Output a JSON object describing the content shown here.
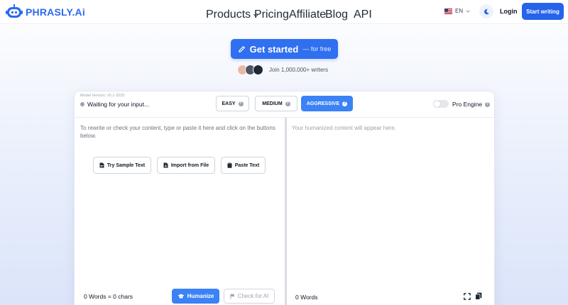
{
  "brand": {
    "name": "PHRASLY.Ai",
    "color": "#2b6af0"
  },
  "nav": {
    "products": "Products",
    "pricing": "Pricing",
    "affiliate": "Affiliate",
    "blog": "Blog",
    "api": "API"
  },
  "header": {
    "language": "EN",
    "language_icon": "us-flag-icon",
    "theme_icon": "moon-icon",
    "login": "Login",
    "start_writing": "Start writing",
    "accent": "#2563eb"
  },
  "hero": {
    "cta_main": "Get started",
    "cta_sub": "— for free",
    "cta_icon": "pencil-icon",
    "writers_text": "Join 1,000,000+ writers"
  },
  "editor": {
    "model_version": "Model Version: v5.1-2025",
    "status": "Waiting for your input...",
    "modes": [
      {
        "label": "EASY",
        "active": false
      },
      {
        "label": "MEDIUM",
        "active": false
      },
      {
        "label": "AGGRESSIVE",
        "active": true
      }
    ],
    "pro_engine": {
      "label": "Pro Engine",
      "enabled": false
    },
    "input_placeholder": "To rewrite or check your content, type or paste it here and click on the buttons below.",
    "output_placeholder": "Your humanized content will appear here.",
    "actions": [
      {
        "label": "Try Sample Text",
        "icon": "document-icon"
      },
      {
        "label": "Import from File",
        "icon": "file-import-icon"
      },
      {
        "label": "Paste Text",
        "icon": "clipboard-icon"
      }
    ],
    "left_count": "0 Words = 0 chars",
    "humanize": "Humanize",
    "check_ai": "Check for AI",
    "right_count": "0 Words"
  }
}
